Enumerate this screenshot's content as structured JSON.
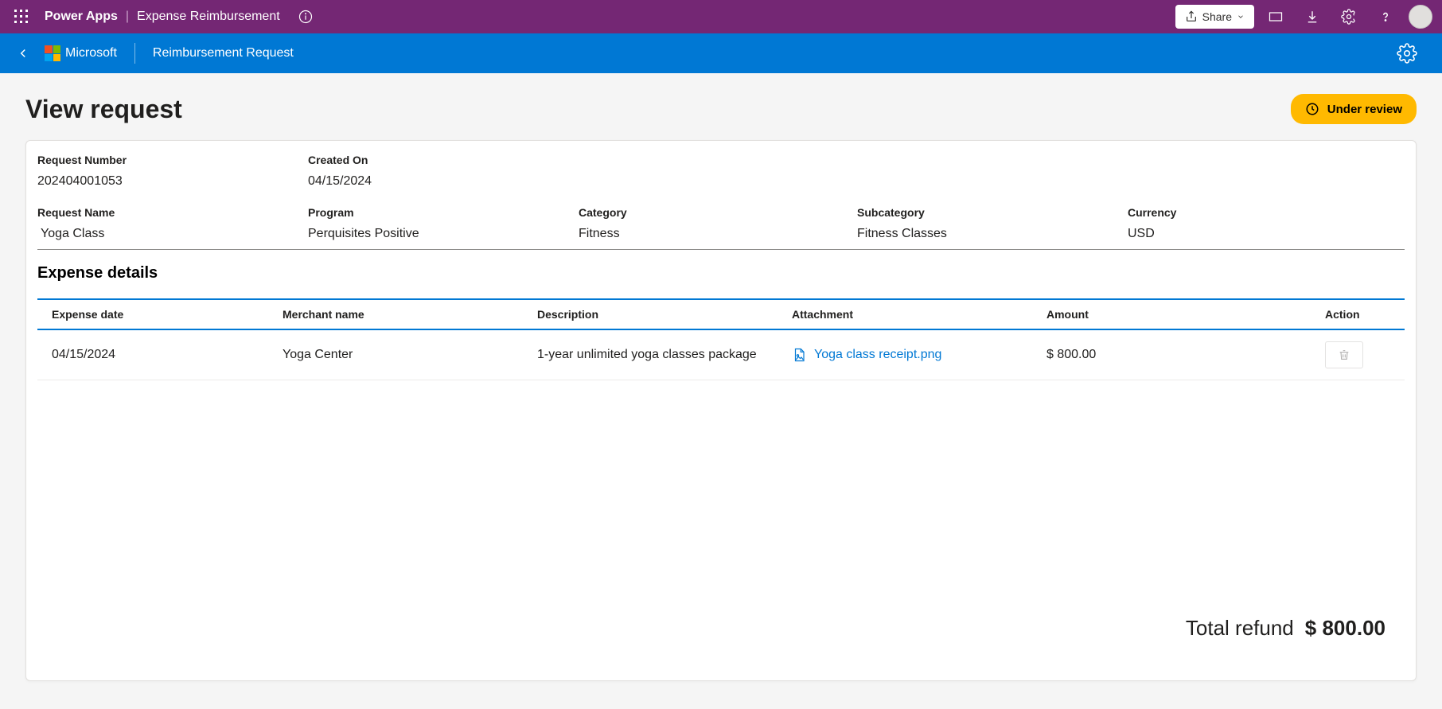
{
  "chrome": {
    "platform": "Power Apps",
    "app_name": "Expense Reimbursement",
    "share": "Share"
  },
  "header": {
    "brand": "Microsoft",
    "title": "Reimbursement Request"
  },
  "page": {
    "title": "View request",
    "status": "Under review"
  },
  "request": {
    "request_number_label": "Request Number",
    "request_number": "202404001053",
    "created_on_label": "Created On",
    "created_on": "04/15/2024",
    "request_name_label": "Request Name",
    "request_name": "Yoga Class",
    "program_label": "Program",
    "program": "Perquisites Positive",
    "category_label": "Category",
    "category": "Fitness",
    "subcategory_label": "Subcategory",
    "subcategory": "Fitness Classes",
    "currency_label": "Currency",
    "currency": "USD"
  },
  "expense": {
    "section_title": "Expense details",
    "headers": {
      "date": "Expense date",
      "merchant": "Merchant name",
      "desc": "Description",
      "attach": "Attachment",
      "amount": "Amount",
      "action": "Action"
    },
    "rows": [
      {
        "date": "04/15/2024",
        "merchant": "Yoga Center",
        "desc": "1-year unlimited yoga classes package",
        "attachment": "Yoga class receipt.png",
        "amount": "$ 800.00"
      }
    ],
    "total_label": "Total refund",
    "total_value": "$ 800.00"
  }
}
